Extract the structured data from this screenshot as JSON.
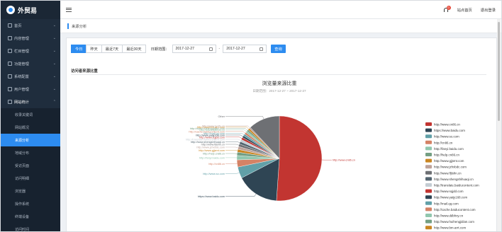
{
  "brand": {
    "name": "外贸易"
  },
  "sidebar": {
    "items": [
      {
        "label": "首页"
      },
      {
        "label": "内容管理"
      },
      {
        "label": "栏目管理"
      },
      {
        "label": "功能管理"
      },
      {
        "label": "系统配置"
      },
      {
        "label": "用户管理"
      },
      {
        "label": "网站统计"
      }
    ],
    "sub_items": [
      {
        "label": "收录关键词"
      },
      {
        "label": "网站概况"
      },
      {
        "label": "来源分析"
      },
      {
        "label": "地域分布"
      },
      {
        "label": "受访页面"
      },
      {
        "label": "访问明细"
      },
      {
        "label": "浏览器"
      },
      {
        "label": "操作系统"
      },
      {
        "label": "终端设备"
      },
      {
        "label": "访问时间"
      }
    ]
  },
  "topbar": {
    "badge": "0",
    "home_link": "站点首页",
    "logout": "退出登录"
  },
  "breadcrumb": {
    "current": "来源分析"
  },
  "filters": {
    "buttons": [
      "今日",
      "昨天",
      "最近7天",
      "最近30天"
    ],
    "date_label": "日期范围：",
    "start": "2017-12-27",
    "end": "2017-12-27",
    "query": "查询"
  },
  "section": {
    "title": "访问者来源比重"
  },
  "chart_data": {
    "type": "pie",
    "title": "浏览量来源比重",
    "subtitle": "日期范围：2017-12-27 ~ 2017-12-27",
    "legend_position": "right",
    "slices": [
      {
        "label": "http://www.cn86.cn",
        "value": 47.0,
        "color": "#c23531"
      },
      {
        "label": "https://www.baidu.com",
        "value": 15.0,
        "color": "#2f4554"
      },
      {
        "label": "http://www.so.com",
        "value": 4.0,
        "color": "#61a0a8"
      },
      {
        "label": "http://cn86.cn",
        "value": 2.5,
        "color": "#d48265"
      },
      {
        "label": "http://fanyi.baidu.com",
        "value": 1.5,
        "color": "#91c7ae"
      },
      {
        "label": "http://help.cn86.cn",
        "value": 1.2,
        "color": "#749f83"
      },
      {
        "label": "http://www.gjjsmt.com",
        "value": 1.0,
        "color": "#ca8622"
      },
      {
        "label": "http://www.jzhxbdc.com",
        "value": 1.0,
        "color": "#bda29a"
      },
      {
        "label": "http://www.fljlsfm.cn",
        "value": 0.9,
        "color": "#6e7074"
      },
      {
        "label": "http://www.shengshihuaqi.cn",
        "value": 0.9,
        "color": "#546570"
      },
      {
        "label": "http://translate.baiducontent.com",
        "value": 0.8,
        "color": "#c4ccd3"
      },
      {
        "label": "http://www.sqjdd.com",
        "value": 0.8,
        "color": "#c23531"
      },
      {
        "label": "http://www.yaijy168.com",
        "value": 0.7,
        "color": "#2f4554"
      },
      {
        "label": "http://mail.qq.com",
        "value": 0.7,
        "color": "#61a0a8"
      },
      {
        "label": "http://cache.baiducontent.com",
        "value": 0.7,
        "color": "#d48265"
      },
      {
        "label": "http://www.ddbhxy.cn",
        "value": 0.6,
        "color": "#91c7ae"
      },
      {
        "label": "http://www.huihengjidian.com",
        "value": 0.6,
        "color": "#749f83"
      },
      {
        "label": "http://www.bm-arrt.com",
        "value": 0.6,
        "color": "#ca8622"
      },
      {
        "label": "http://www.lyzjfu.cn",
        "value": 0.5,
        "color": "#bda29a"
      },
      {
        "label": "Other",
        "value": 11.0,
        "color": "#6e7074"
      }
    ]
  }
}
